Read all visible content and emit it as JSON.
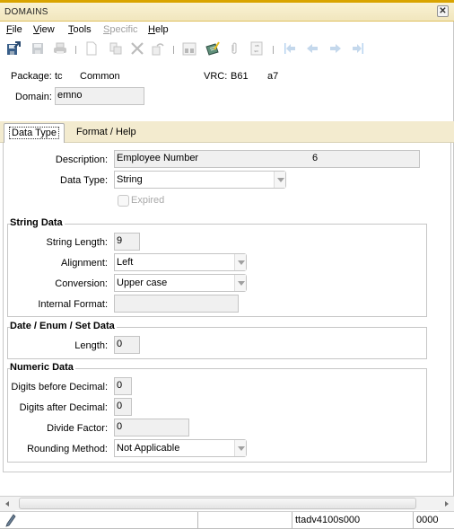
{
  "window": {
    "title": "DOMAINS",
    "close_icon": "close-icon"
  },
  "menu": {
    "items": [
      {
        "label": "File",
        "mnemonic": "F",
        "rest": "ile",
        "enabled": true
      },
      {
        "label": "View",
        "mnemonic": "V",
        "rest": "iew",
        "enabled": true
      },
      {
        "label": "Tools",
        "mnemonic": "T",
        "rest": "ools",
        "enabled": true
      },
      {
        "label": "Specific",
        "mnemonic": "S",
        "rest": "pecific",
        "enabled": false
      },
      {
        "label": "Help",
        "mnemonic": "H",
        "rest": "elp",
        "enabled": true
      }
    ]
  },
  "toolbar": {
    "icons": [
      "save-and-exit-icon",
      "save-icon",
      "print-icon",
      "new-icon",
      "copy-icon",
      "delete-icon",
      "undo-icon",
      "find-icon",
      "edit-note-icon",
      "attachment-icon",
      "refresh-icon",
      "first-record-icon",
      "previous-record-icon",
      "next-record-icon",
      "last-record-icon"
    ]
  },
  "header": {
    "package_label": "Package:",
    "package_code": "tc",
    "package_name": "Common",
    "vrc_label": "VRC:",
    "vrc_version": "B61",
    "vrc_release": "a7",
    "domain_label": "Domain:",
    "domain_value": "emno"
  },
  "tabs": [
    {
      "label": "Data Type",
      "active": true
    },
    {
      "label": "Format / Help",
      "active": false
    }
  ],
  "data_type": {
    "description_label": "Description:",
    "description_value": "Employee Number",
    "description_extra": "6",
    "data_type_label": "Data Type:",
    "data_type_value": "String",
    "expired_label": "Expired",
    "expired_checked": false
  },
  "string_data": {
    "title": "String Data",
    "string_length_label": "String Length:",
    "string_length_value": "9",
    "alignment_label": "Alignment:",
    "alignment_value": "Left",
    "conversion_label": "Conversion:",
    "conversion_value": "Upper case",
    "internal_format_label": "Internal Format:",
    "internal_format_value": ""
  },
  "date_enum_set": {
    "title": "Date / Enum / Set Data",
    "length_label": "Length:",
    "length_value": "0"
  },
  "numeric_data": {
    "title": "Numeric Data",
    "digits_before_label": "Digits before Decimal:",
    "digits_before_value": "0",
    "digits_after_label": "Digits after Decimal:",
    "digits_after_value": "0",
    "divide_factor_label": "Divide Factor:",
    "divide_factor_value": "0",
    "rounding_label": "Rounding Method:",
    "rounding_value": "Not Applicable"
  },
  "statusbar": {
    "cell1": "",
    "cell2": "",
    "session": "ttadv4100s000",
    "company": "0000"
  }
}
